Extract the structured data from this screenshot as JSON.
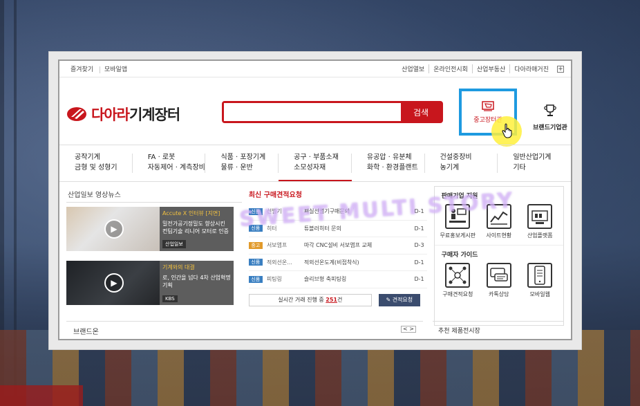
{
  "topbar": {
    "favorites": "즐겨찾기",
    "mobile_app": "모바일앱",
    "links": [
      "산업열보",
      "온라인전시회",
      "산업부동산",
      "다아라매거진"
    ],
    "plus": "+"
  },
  "header": {
    "logo_red": "다아라",
    "logo_black": "기계장터",
    "search_placeholder": "",
    "search_button": "검색",
    "used_market": "중고장터관",
    "brand_company": "브랜드기업관"
  },
  "nav": [
    {
      "line1": "공작기계",
      "line2": "금형 및 성형기"
    },
    {
      "line1": "FA · 로봇",
      "line2": "자동제어 · 계측장비"
    },
    {
      "line1": "식품 · 포장기계",
      "line2": "물류 · 운반"
    },
    {
      "line1": "공구 · 부품소재",
      "line2": "소모성자재"
    },
    {
      "line1": "유공압 · 유분체",
      "line2": "화학 · 환경플랜트"
    },
    {
      "line1": "건설중장비",
      "line2": "농기계"
    },
    {
      "line1": "일반산업기계",
      "line2": "기타"
    }
  ],
  "news": {
    "title": "산업일보 영상뉴스",
    "cards": [
      {
        "tag": "Accute X 인터뷰 [지면]",
        "body": "밀전가공기정밀도 향상시킨 컨팀기술 리니어 모터로 인증",
        "source": "산업일보"
      },
      {
        "tag": "기계와의 대결",
        "body": "로, 인간을 넘다 4차 산업혁명 기획",
        "source": "KBS"
      }
    ]
  },
  "quotes": {
    "title": "최신 구매견적요청",
    "rows": [
      {
        "badge": "신품",
        "badge_color": "#3a7fc1",
        "category": "선별기",
        "name": "폐실선별기구매문의",
        "d": "D-1"
      },
      {
        "badge": "신품",
        "badge_color": "#3a7fc1",
        "category": "히터",
        "name": "튜블러히터 문의",
        "d": "D-1"
      },
      {
        "badge": "중고",
        "badge_color": "#e19a2b",
        "category": "서보앰프",
        "name": "마각 CNC설비 서보앰프 교체",
        "d": "D-3"
      },
      {
        "badge": "신품",
        "badge_color": "#3a7fc1",
        "category": "적외선온...",
        "name": "적외선온도계(비접착식)",
        "d": "D-1"
      },
      {
        "badge": "신품",
        "badge_color": "#3a7fc1",
        "category": "피팅링",
        "name": "슬리브형 축피팅링",
        "d": "D-1"
      }
    ],
    "live_prefix": "실시간 거래 진행 중 ",
    "live_count": "251",
    "live_suffix": "건",
    "request_button": "견적요청"
  },
  "side": {
    "seller_title": "판매기업 지원",
    "seller_items": [
      "무료홍보게시판",
      "사이트현황",
      "산업플랫폼"
    ],
    "buyer_title": "구매자 가이드",
    "buyer_items": [
      "구매견적요청",
      "카톡상담",
      "모바일웹"
    ]
  },
  "footer": {
    "brand_on": "브랜드온",
    "arrows": "< >",
    "recommend": "추천 제품전시장"
  },
  "watermark": "SWEET MULTI STORY",
  "colors": {
    "accent_red": "#c8161d",
    "highlight_blue": "#1e9ae0",
    "button_navy": "#3b4c6e"
  }
}
